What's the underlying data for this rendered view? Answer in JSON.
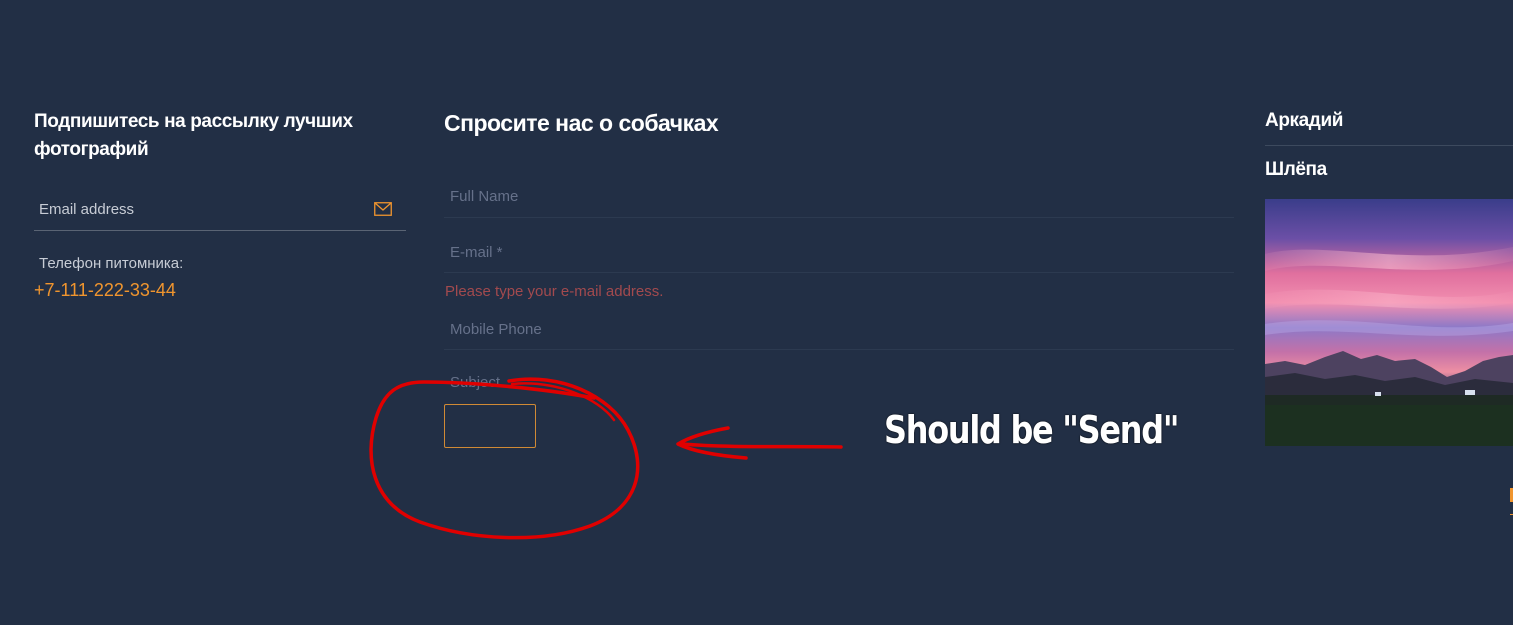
{
  "subscribe": {
    "heading": "Подпишитесь на рассылку лучших фотографий",
    "email_placeholder": "Email address",
    "phone_label": "Телефон питомника:",
    "phone_number": "+7-111-222-33-44",
    "icon": "mail-icon"
  },
  "contact_form": {
    "heading": "Спросите нас о собачках",
    "fields": {
      "full_name": {
        "placeholder": "Full Name",
        "value": ""
      },
      "email": {
        "placeholder": "E-mail *",
        "value": ""
      },
      "mobile_phone": {
        "placeholder": "Mobile Phone",
        "value": ""
      },
      "subject": {
        "placeholder": "Subject",
        "value": ""
      }
    },
    "error_message": "Please type your e-mail address.",
    "submit_label": ""
  },
  "sidebar_right": {
    "title": "Аркадий",
    "subtitle": "Шлёпа",
    "image_subject": "sunset-over-mountains-photo"
  },
  "annotation": {
    "text": "Should be \"Send\"",
    "color": "#e00000"
  },
  "colors": {
    "background": "#222f45",
    "accent": "#f0952e",
    "error": "#a24a4e",
    "heading": "#ffffff"
  }
}
